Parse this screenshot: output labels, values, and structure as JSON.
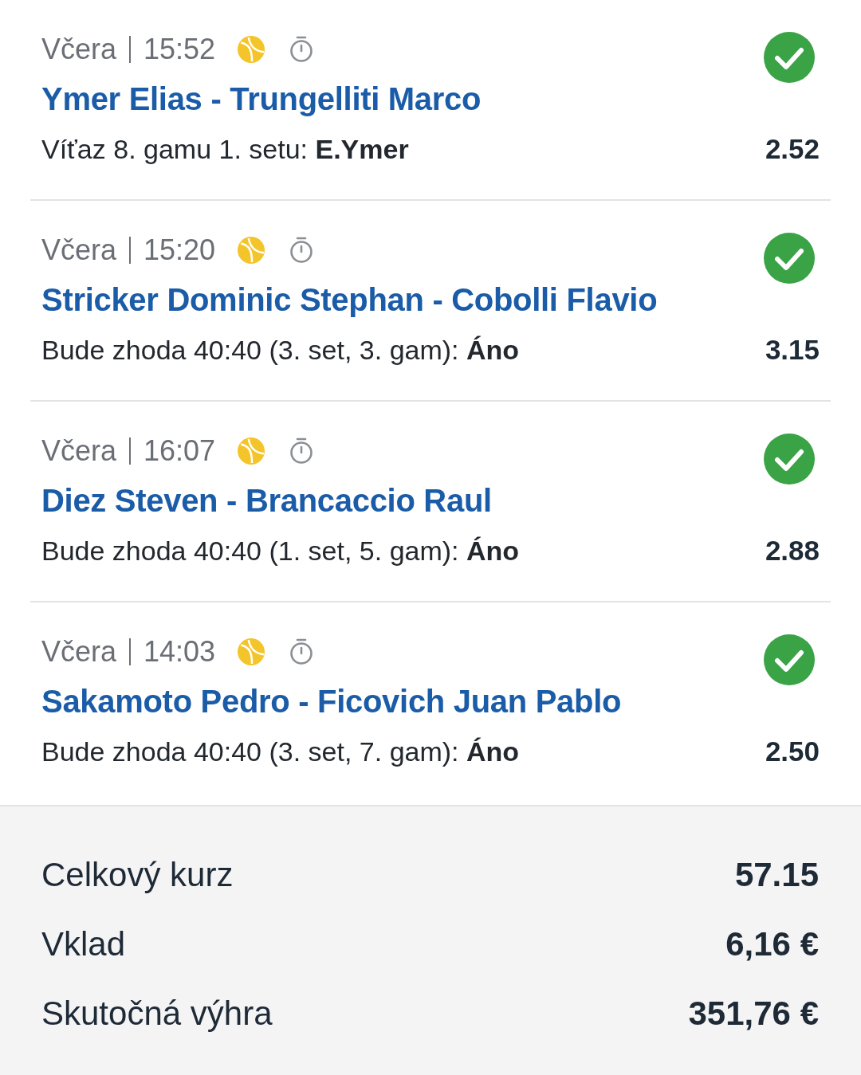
{
  "bets": [
    {
      "day": "Včera",
      "time": "15:52",
      "timer": true,
      "match": "Ymer Elias - Trungelliti Marco",
      "market": "Víťaz 8. gamu 1. setu: **E.Ymer**",
      "odds": "2.52",
      "won": true
    },
    {
      "day": "Včera",
      "time": "15:20",
      "timer": true,
      "match": "Stricker Dominic Stephan - Cobolli Flavio",
      "market": "Bude zhoda 40:40 (3. set, 3. gam): **Áno**",
      "odds": "3.15",
      "won": true
    },
    {
      "day": "Včera",
      "time": "16:07",
      "timer": true,
      "match": "Diez Steven - Brancaccio Raul",
      "market": "Bude zhoda 40:40 (1. set, 5. gam): **Áno**",
      "odds": "2.88",
      "won": true
    },
    {
      "day": "Včera",
      "time": "14:03",
      "timer": true,
      "match": "Sakamoto Pedro - Ficovich Juan Pablo",
      "market": "Bude zhoda 40:40 (3. set, 7. gam): **Áno**",
      "odds": "2.50",
      "won": true
    }
  ],
  "summary": {
    "rows": [
      {
        "label": "Celkový kurz",
        "value": "57.15"
      },
      {
        "label": "Vklad",
        "value": "6,16 €"
      },
      {
        "label": "Skutočná výhra",
        "value": "351,76 €"
      }
    ]
  }
}
